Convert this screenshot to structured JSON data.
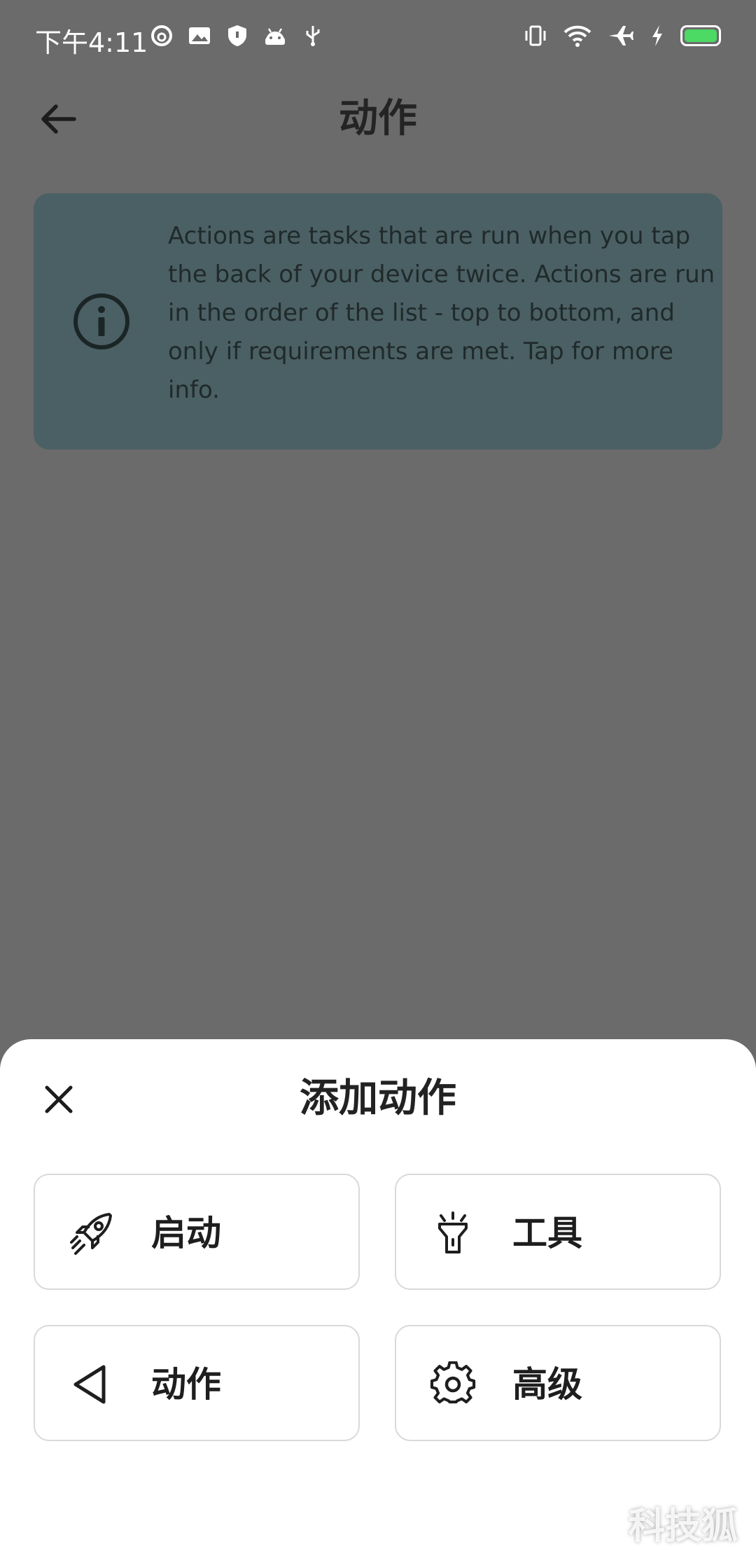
{
  "status_bar": {
    "time": "下午4:11",
    "left_icons": [
      "netease-music-icon",
      "image-icon",
      "shield-icon",
      "android-icon",
      "usb-icon"
    ],
    "right_icons": [
      "vibrate-icon",
      "wifi-icon",
      "airplane-icon",
      "charging-icon",
      "battery-icon"
    ],
    "battery_color": "#4cd964"
  },
  "app_bar": {
    "title": "动作",
    "back_icon": "arrow-left-icon"
  },
  "info_card": {
    "icon": "info-circle-icon",
    "text": "Actions are tasks that are run when you tap the back of your device twice. Actions are run in the order of the list - top to bottom, and only if requirements are met. Tap for more info.",
    "background": "#4b6064"
  },
  "bottom_sheet": {
    "title": "添加动作",
    "close_icon": "close-icon",
    "categories": [
      {
        "label": "启动",
        "icon": "rocket-icon"
      },
      {
        "label": "工具",
        "icon": "flashlight-icon"
      },
      {
        "label": "动作",
        "icon": "triangle-back-icon"
      },
      {
        "label": "高级",
        "icon": "gear-icon"
      }
    ]
  },
  "watermark": "科技狐"
}
